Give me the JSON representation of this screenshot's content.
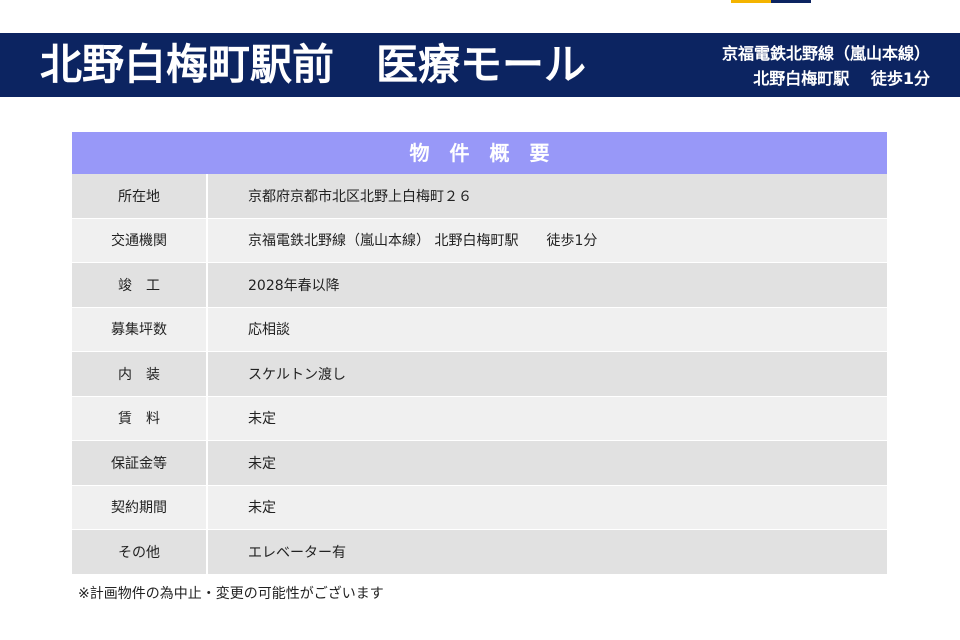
{
  "colors": {
    "header_bg": "#0c2461",
    "header_text": "#ffffff",
    "table_title_bg": "#9898f8",
    "row_dark": "#e1e1e1",
    "row_light": "#f0f0f0",
    "accent_left": "#f4b400",
    "accent_right": "#0c2461"
  },
  "header": {
    "title": "北野白梅町駅前　医療モール",
    "access_line1": "京福電鉄北野線（嵐山本線）",
    "access_line2": "北野白梅町駅　 徒歩1分"
  },
  "table": {
    "title": "物　件　概　要",
    "rows": [
      {
        "label": "所在地",
        "value": "京都府京都市北区北野上白梅町２６"
      },
      {
        "label": "交通機関",
        "value": "京福電鉄北野線（嵐山本線） 北野白梅町駅　　徒歩1分"
      },
      {
        "label": "竣　工",
        "value": "2028年春以降"
      },
      {
        "label": "募集坪数",
        "value": "応相談"
      },
      {
        "label": "内　装",
        "value": "スケルトン渡し"
      },
      {
        "label": "賃　料",
        "value": "未定"
      },
      {
        "label": "保証金等",
        "value": "未定"
      },
      {
        "label": "契約期間",
        "value": "未定"
      },
      {
        "label": "その他",
        "value": "エレベーター有"
      }
    ]
  },
  "footnote": "※計画物件の為中止・変更の可能性がございます"
}
